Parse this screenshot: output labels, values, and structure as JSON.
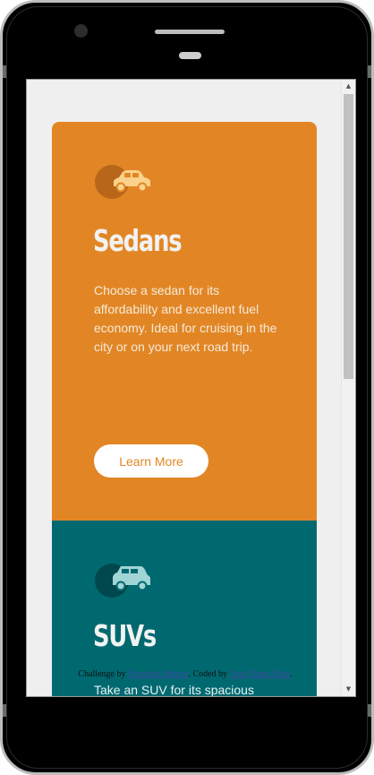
{
  "cards": [
    {
      "icon": "sedan-car-icon",
      "title": "Sedans",
      "text": "Choose a sedan for its affordability and excellent fuel economy. Ideal for cruising in the city or on your next road trip.",
      "button": "Learn More",
      "color": "#e28625"
    },
    {
      "icon": "suv-icon",
      "title": "SUVs",
      "text": "Take an SUV for its spacious",
      "color": "#006970"
    }
  ],
  "attribution": {
    "prefix": "Challenge by ",
    "challenge_link": "Frontend Mentor",
    "middle": ". Coded by ",
    "author_link": "Your Name Here",
    "suffix": "."
  },
  "colors": {
    "sedan": "#e28625",
    "suv": "#006970",
    "page": "#efefef"
  }
}
